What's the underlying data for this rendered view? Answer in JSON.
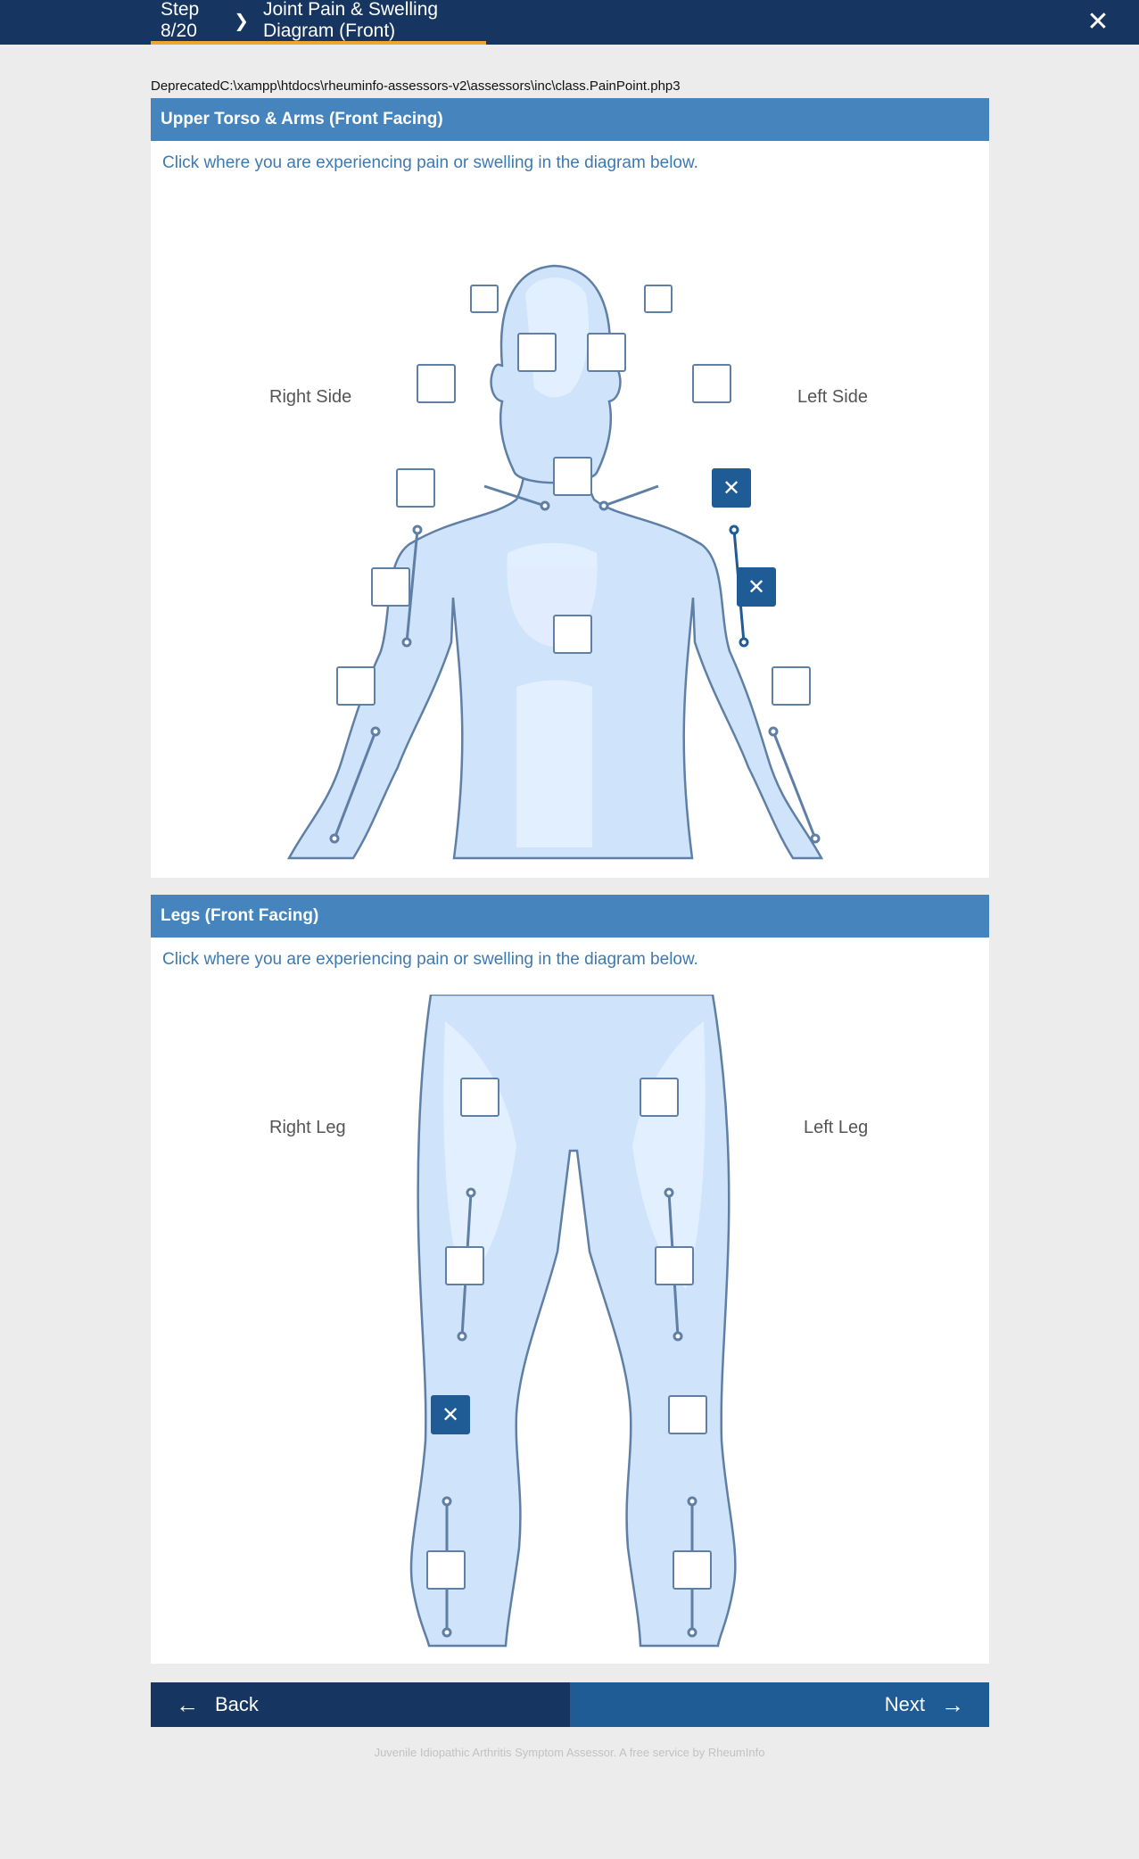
{
  "header": {
    "step": "Step 8/20",
    "separator_icon": "chevron-right-icon",
    "title": "Joint Pain & Swelling Diagram (Front)",
    "close_icon": "close-icon",
    "progress_color": "#f0a433"
  },
  "deprecated_notice": "DeprecatedC:\\xampp\\htdocs\\rheuminfo-assessors-v2\\assessors\\inc\\class.PainPoint.php3",
  "upper": {
    "title": "Upper Torso & Arms (Front Facing)",
    "instruction": "Click where you are experiencing pain or swelling in the diagram below.",
    "right_label": "Right Side",
    "left_label": "Left Side",
    "points": [
      {
        "id": "right-jaw",
        "selected": false
      },
      {
        "id": "left-jaw",
        "selected": false
      },
      {
        "id": "right-collarbone",
        "selected": false
      },
      {
        "id": "left-collarbone",
        "selected": false
      },
      {
        "id": "right-shoulder",
        "selected": false
      },
      {
        "id": "left-shoulder",
        "selected": false
      },
      {
        "id": "sternum",
        "selected": false
      },
      {
        "id": "right-upper-arm",
        "selected": false
      },
      {
        "id": "left-upper-arm",
        "selected": true
      },
      {
        "id": "right-elbow",
        "selected": false
      },
      {
        "id": "left-elbow",
        "selected": true
      },
      {
        "id": "abdomen",
        "selected": false
      },
      {
        "id": "right-forearm",
        "selected": false
      },
      {
        "id": "left-forearm",
        "selected": false
      }
    ]
  },
  "legs": {
    "title": "Legs (Front Facing)",
    "instruction": "Click where you are experiencing pain or swelling in the diagram below.",
    "right_label": "Right Leg",
    "left_label": "Left Leg",
    "points": [
      {
        "id": "right-hip",
        "selected": false
      },
      {
        "id": "left-hip",
        "selected": false
      },
      {
        "id": "right-thigh",
        "selected": false
      },
      {
        "id": "left-thigh",
        "selected": false
      },
      {
        "id": "right-knee",
        "selected": true
      },
      {
        "id": "left-knee",
        "selected": false
      },
      {
        "id": "right-shin",
        "selected": false
      },
      {
        "id": "left-shin",
        "selected": false
      }
    ]
  },
  "nav": {
    "back_label": "Back",
    "next_label": "Next",
    "back_icon": "arrow-left-icon",
    "next_icon": "arrow-right-icon"
  },
  "footer": "Juvenile Idiopathic Arthritis Symptom Assessor. A free service by RheumInfo",
  "colors": {
    "header_bg": "#163560",
    "panel_header": "#4584bd",
    "selected": "#1f5c96",
    "next_bg": "#1f5c96",
    "body_fill": "#cfe3fb",
    "body_outline": "#5f7fa5"
  }
}
